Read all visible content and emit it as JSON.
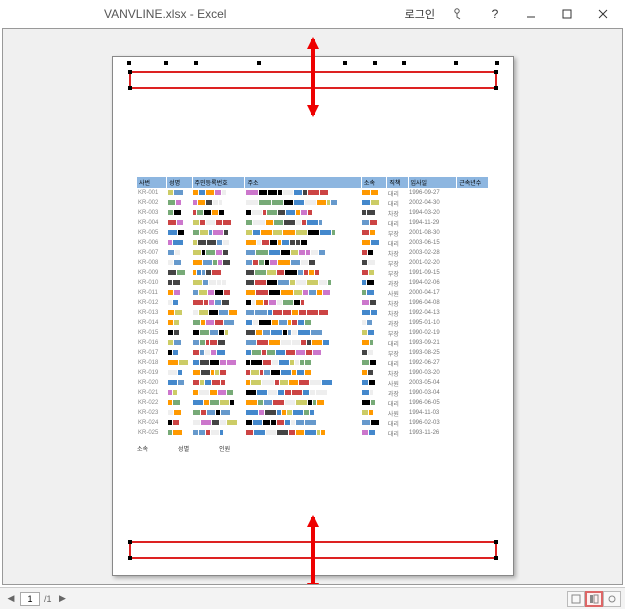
{
  "window": {
    "title": "VANVLINE.xlsx  -  Excel",
    "login": "로그인"
  },
  "statusbar": {
    "page_current": "1",
    "page_total": "/1"
  },
  "sheet": {
    "headers": [
      "사번",
      "성명",
      "주민등록번호",
      "주소",
      "소속",
      "직책",
      "입사일",
      "근속년수"
    ],
    "rows": [
      {
        "id": "KR-001",
        "dept": "대리",
        "date": "1996-09-27"
      },
      {
        "id": "KR-002",
        "dept": "대리",
        "date": "2002-04-30"
      },
      {
        "id": "KR-003",
        "dept": "차장",
        "date": "1994-03-20"
      },
      {
        "id": "KR-004",
        "dept": "대리",
        "date": "1994-11-29"
      },
      {
        "id": "KR-005",
        "dept": "부장",
        "date": "2001-08-30"
      },
      {
        "id": "KR-006",
        "dept": "대리",
        "date": "2003-06-15"
      },
      {
        "id": "KR-007",
        "dept": "차장",
        "date": "2003-02-28"
      },
      {
        "id": "KR-008",
        "dept": "부장",
        "date": "2001-02-20"
      },
      {
        "id": "KR-009",
        "dept": "부장",
        "date": "1991-09-15"
      },
      {
        "id": "KR-010",
        "dept": "과장",
        "date": "1994-02-06"
      },
      {
        "id": "KR-011",
        "dept": "사원",
        "date": "2000-04-17"
      },
      {
        "id": "KR-012",
        "dept": "차장",
        "date": "1996-04-08"
      },
      {
        "id": "KR-013",
        "dept": "차장",
        "date": "1992-04-13"
      },
      {
        "id": "KR-014",
        "dept": "과장",
        "date": "1995-01-10"
      },
      {
        "id": "KR-015",
        "dept": "부장",
        "date": "1990-02-19"
      },
      {
        "id": "KR-016",
        "dept": "대리",
        "date": "1993-09-21"
      },
      {
        "id": "KR-017",
        "dept": "부장",
        "date": "1993-08-25"
      },
      {
        "id": "KR-018",
        "dept": "대리",
        "date": "1992-06-27"
      },
      {
        "id": "KR-019",
        "dept": "차장",
        "date": "1990-03-20"
      },
      {
        "id": "KR-020",
        "dept": "사원",
        "date": "2003-05-04"
      },
      {
        "id": "KR-021",
        "dept": "과장",
        "date": "1990-03-04"
      },
      {
        "id": "KR-022",
        "dept": "대리",
        "date": "1996-06-05"
      },
      {
        "id": "KR-023",
        "dept": "사원",
        "date": "1994-11-03"
      },
      {
        "id": "KR-024",
        "dept": "대리",
        "date": "1996-02-03"
      },
      {
        "id": "KR-025",
        "dept": "대리",
        "date": "1993-11-26"
      }
    ],
    "legend": [
      "소속",
      "성별",
      "인원"
    ]
  }
}
